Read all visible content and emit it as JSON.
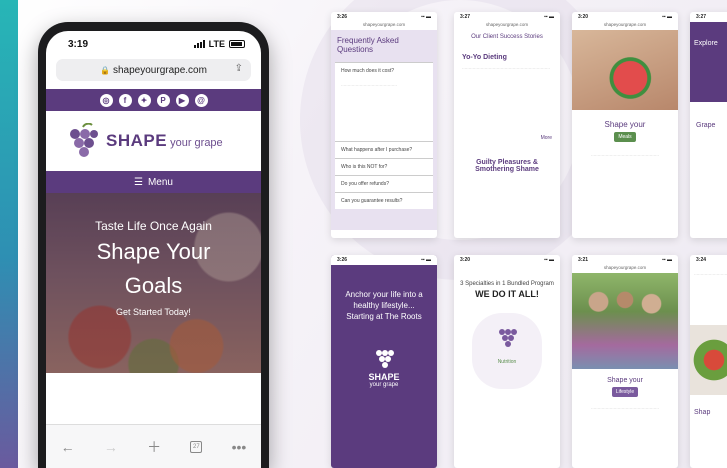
{
  "phone": {
    "status": {
      "time": "3:19",
      "network": "LTE"
    },
    "url": "shapeyourgrape.com",
    "social_icons": [
      "instagram-icon",
      "facebook-icon",
      "twitter-icon",
      "pinterest-icon",
      "youtube-icon",
      "email-icon"
    ],
    "logo": {
      "brand": "SHAPE",
      "tagline": "your grape"
    },
    "menu_label": "Menu",
    "hero": {
      "subtitle": "Taste Life Once Again",
      "title_line1": "Shape Your",
      "title_line2": "Goals",
      "cta": "Get Started Today!"
    }
  },
  "thumbnails": {
    "faq": {
      "time": "3:26",
      "title": "Frequently Asked Questions",
      "questions": [
        "How much does it cost?",
        "What happens after I purchase?",
        "Who is this NOT for?",
        "Do you offer refunds?",
        "Can you guarantee results?"
      ]
    },
    "success": {
      "time": "3:27",
      "title": "Our Client Success Stories",
      "story1": "Yo-Yo Dieting",
      "story2": "Guilty Pleasures & Smothering Shame",
      "more": "More"
    },
    "meals": {
      "time": "3:20",
      "heading": "Shape your",
      "tag": "Meals"
    },
    "grape": {
      "time": "3:27",
      "heading": "Grape",
      "line": "Explore"
    },
    "roots": {
      "time": "3:26",
      "text": "Anchor your life into a healthy lifestyle... Starting at The Roots",
      "brand": "SHAPE",
      "tagline": "your grape"
    },
    "specialties": {
      "time": "3:20",
      "line1": "3 Specialties in 1 Bundled Program",
      "line2": "WE DO IT ALL!",
      "label": "Nutrition"
    },
    "lifestyle": {
      "time": "3:21",
      "heading": "Shape your",
      "tag": "Lifestyle"
    },
    "edge": {
      "time": "3:24",
      "heading": "Shap"
    }
  }
}
